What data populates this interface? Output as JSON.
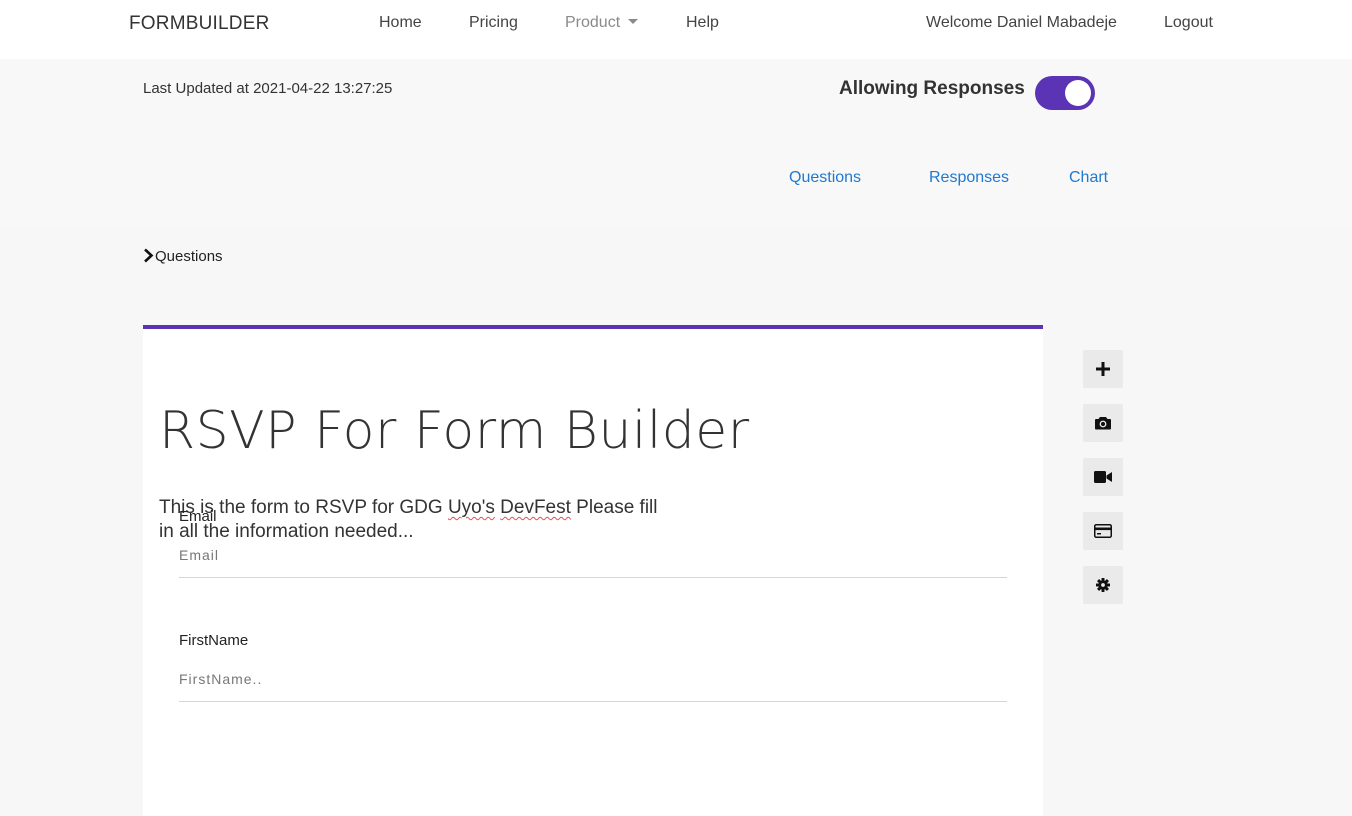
{
  "navbar": {
    "brand": "FORMBUILDER",
    "home": "Home",
    "pricing": "Pricing",
    "product": "Product",
    "help": "Help",
    "welcome": "Welcome Daniel Mabadeje",
    "logout": "Logout"
  },
  "header": {
    "last_updated": "Last Updated at 2021-04-22 13:27:25",
    "allowing_responses_label": "Allowing Responses",
    "allowing_responses_on": true,
    "accent_color": "#5a34b4",
    "tabs": [
      "Questions",
      "Responses",
      "Chart"
    ]
  },
  "breadcrumb": {
    "label": "Questions",
    "icon": "chevron-right-icon"
  },
  "form": {
    "title": "RSVP For Form Builder",
    "description_before": "This is the form to RSVP for GDG ",
    "description_misspelled_1": "Uyo's",
    "description_space": " ",
    "description_misspelled_2": "DevFest",
    "description_after": " Please fill in all the information needed...",
    "fields": [
      {
        "label": "Email",
        "placeholder": "Email",
        "value": ""
      },
      {
        "label": "FirstName",
        "placeholder": "FirstName..",
        "value": ""
      }
    ]
  },
  "tools": [
    {
      "name": "add-question",
      "icon": "plus-icon"
    },
    {
      "name": "add-image",
      "icon": "camera-icon"
    },
    {
      "name": "add-video",
      "icon": "video-icon"
    },
    {
      "name": "add-payment",
      "icon": "credit-card-icon"
    },
    {
      "name": "settings",
      "icon": "gear-icon"
    }
  ]
}
